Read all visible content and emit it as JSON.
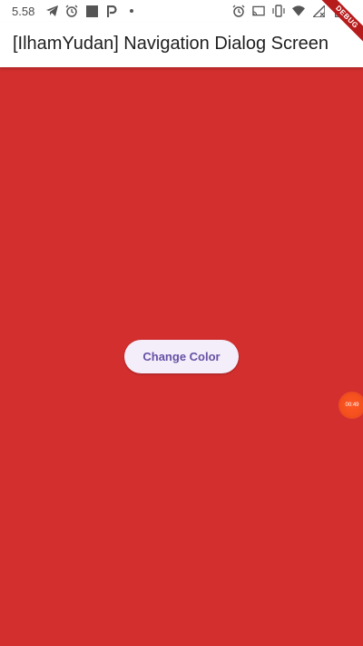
{
  "status_bar": {
    "time": "5.58",
    "icons_left": [
      "telegram-icon",
      "alarm-icon",
      "square-icon",
      "parking-icon",
      "dot-icon"
    ],
    "icons_right": [
      "alarm-icon",
      "cast-icon",
      "vibrate-icon",
      "wifi-icon",
      "no-signal-icon",
      "battery-icon"
    ]
  },
  "app_bar": {
    "title": "[IlhamYudan] Navigation Dialog Screen"
  },
  "body": {
    "background_color": "#d32f2f"
  },
  "button": {
    "label": "Change Color"
  },
  "debug_ribbon": {
    "label": "DEBUG"
  },
  "floating_bubble": {
    "label": "00:49"
  }
}
